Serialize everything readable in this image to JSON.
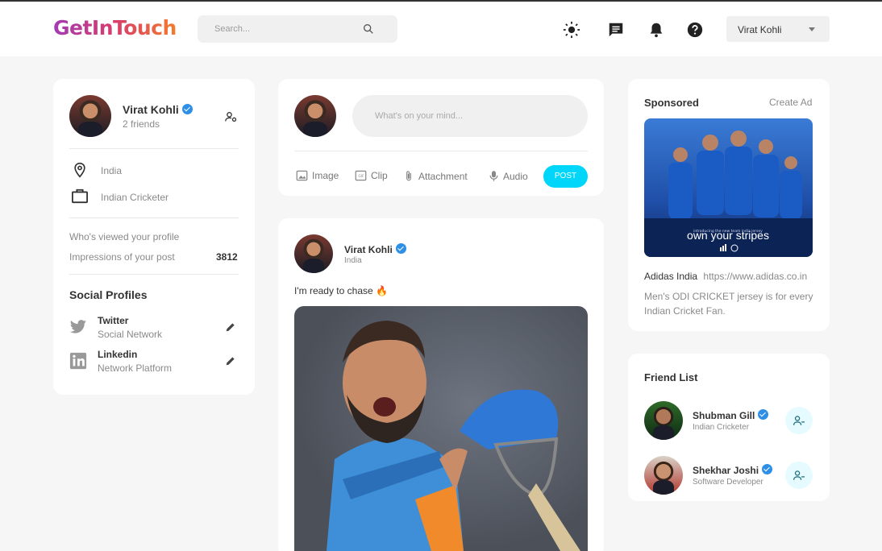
{
  "brand": {
    "logo": "GetInTouch"
  },
  "search": {
    "placeholder": "Search..."
  },
  "nav": {
    "user_name": "Virat Kohli"
  },
  "profile": {
    "name": "Virat Kohli",
    "friends": "2 friends",
    "location": "India",
    "occupation": "Indian Cricketer",
    "viewed_label": "Who's viewed your profile",
    "impressions_label": "Impressions of your post",
    "impressions_value": "3812",
    "social_title": "Social Profiles",
    "socials": [
      {
        "name": "Twitter",
        "desc": "Social Network"
      },
      {
        "name": "Linkedin",
        "desc": "Network Platform"
      }
    ]
  },
  "composer": {
    "placeholder": "What's on your mind...",
    "actions": [
      "Image",
      "Clip",
      "Attachment",
      "Audio"
    ],
    "post_label": "POST"
  },
  "post": {
    "author": "Virat Kohli",
    "location": "India",
    "text": "I'm ready to chase 🔥"
  },
  "sponsored": {
    "title": "Sponsored",
    "create_label": "Create Ad",
    "ad_tagline": "own your stripes",
    "ad_small": "introducing the new team india jersey",
    "brand": "Adidas India",
    "url": "https://www.adidas.co.in",
    "desc": "Men's ODI CRICKET jersey is for every Indian Cricket Fan."
  },
  "friends": {
    "title": "Friend List",
    "items": [
      {
        "name": "Shubman Gill",
        "role": "Indian Cricketer"
      },
      {
        "name": "Shekhar Joshi",
        "role": "Software Developer"
      }
    ]
  },
  "colors": {
    "accent": "#00d5fa",
    "verified": "#2e8fe6",
    "background": "#f6f6f6"
  }
}
